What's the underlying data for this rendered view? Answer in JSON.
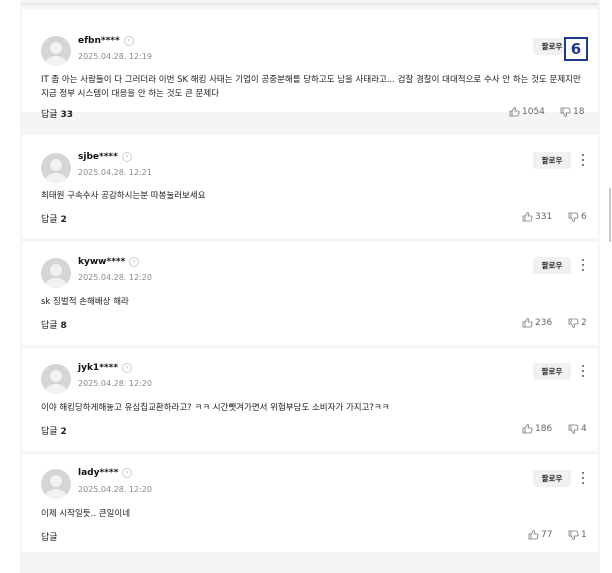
{
  "comments": [
    {
      "username": "efbn****",
      "date": "2025.04.28. 12:19",
      "follow": "팔로우",
      "text": "IT 좀 아는 사람들이 다 그러더라 이번 SK 해킹 사태는 기업이 공중분해를 당하고도 남을 사태라고... 검찰 경찰이 대대적으로 수사 안 하는 것도 문제지만 지금 정부 시스템이 대응을 안 하는 것도 큰 문제다",
      "reply_label": "답글",
      "reply_count": "33",
      "likes": "1054",
      "dislikes": "18"
    },
    {
      "username": "sjbe****",
      "date": "2025.04.28. 12:21",
      "follow": "팔로우",
      "text": "최태원 구속수사 공감하시는분 따봉눌러보세요",
      "reply_label": "답글",
      "reply_count": "2",
      "likes": "331",
      "dislikes": "6"
    },
    {
      "username": "kyww****",
      "date": "2025.04.28. 12:20",
      "follow": "팔로우",
      "text": "sk 징벌적 손해배상 해라",
      "reply_label": "답글",
      "reply_count": "8",
      "likes": "236",
      "dislikes": "2"
    },
    {
      "username": "jyk1****",
      "date": "2025.04.28. 12:20",
      "follow": "팔로우",
      "text": "이야 해킹당하게해놓고 유심칩교환하라고? ㅋㅋ 시간뺏겨가면서 위험부담도 소비자가 가지고?ㅋㅋ",
      "reply_label": "답글",
      "reply_count": "2",
      "likes": "186",
      "dislikes": "4"
    },
    {
      "username": "lady****",
      "date": "2025.04.28. 12:20",
      "follow": "팔로우",
      "text": "이제 시작일듯.. 큰일이네",
      "reply_label": "답글",
      "reply_count": "",
      "likes": "77",
      "dislikes": "1"
    }
  ],
  "overlay_badge": "6",
  "icons": {
    "chevron": "chevron-right-icon",
    "like": "thumbs-up-icon",
    "dislike": "thumbs-down-icon",
    "more": "more-vertical-icon"
  },
  "colors": {
    "badge": "#1b3c8c"
  }
}
